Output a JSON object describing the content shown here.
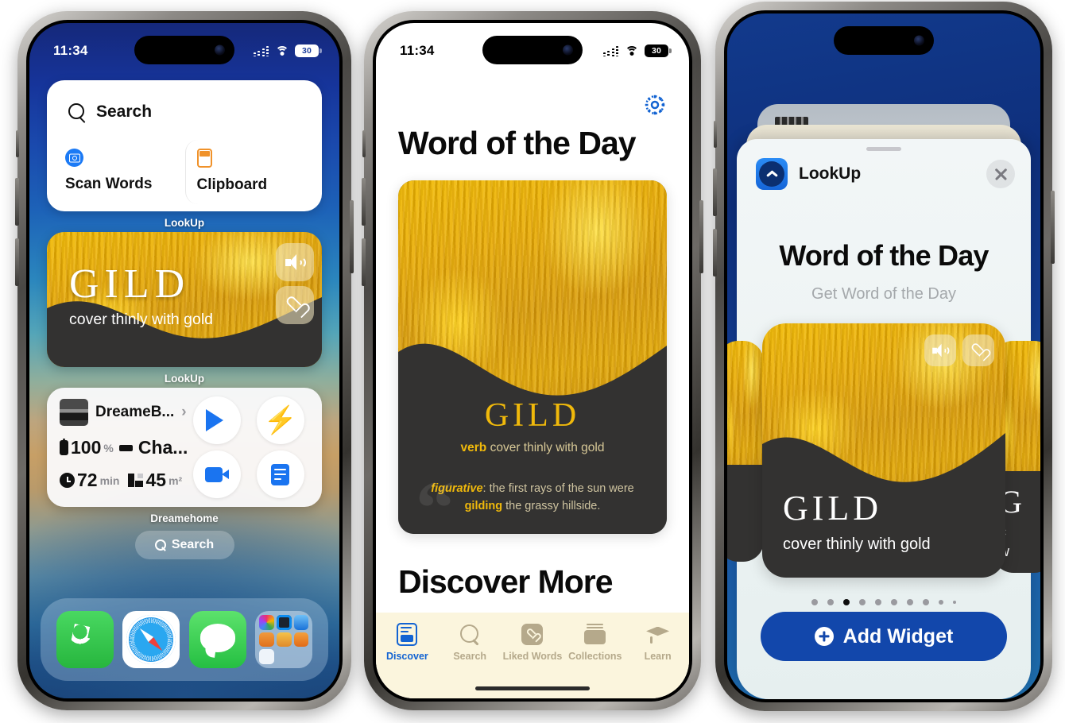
{
  "phone1": {
    "status": {
      "time": "11:34",
      "battery": "30",
      "wifi_icon": "wifi-icon",
      "signal_icon": "cellular-signal-icon"
    },
    "lookup_search_widget": {
      "search_placeholder": "Search",
      "search_icon": "search-icon",
      "actions": [
        {
          "label": "Scan Words",
          "icon": "camera-icon"
        },
        {
          "label": "Clipboard",
          "icon": "clipboard-icon"
        }
      ],
      "widget_name": "LookUp"
    },
    "gild_widget": {
      "word": "GILD",
      "definition": "cover thinly with gold",
      "speaker_icon": "speaker-icon",
      "heart_icon": "heart-icon",
      "widget_name": "LookUp"
    },
    "dream_widget": {
      "device_name": "DreameB...",
      "chevron_icon": "chevron-right-icon",
      "battery_value": "100",
      "battery_unit": "%",
      "charge_status": "Cha...",
      "time_value": "72",
      "time_unit": "min",
      "area_value": "45",
      "area_unit": "m²",
      "buttons": [
        {
          "icon": "play-icon"
        },
        {
          "icon": "bolt-icon"
        },
        {
          "icon": "video-icon"
        },
        {
          "icon": "document-icon"
        }
      ],
      "widget_name": "Dreamehome"
    },
    "home_search": {
      "label": "Search",
      "icon": "search-icon"
    },
    "dock": [
      {
        "name": "Phone",
        "icon": "phone-icon"
      },
      {
        "name": "Safari",
        "icon": "safari-icon"
      },
      {
        "name": "Messages",
        "icon": "messages-icon"
      },
      {
        "name": "Folder",
        "icon": "folder-icon"
      }
    ]
  },
  "phone2": {
    "status": {
      "time": "11:34",
      "battery": "30"
    },
    "settings_icon": "gear-icon",
    "title": "Word of the Day",
    "card": {
      "word": "GILD",
      "part_of_speech": "verb",
      "definition": "cover thinly with gold",
      "example_label": "figurative",
      "example_prefix": ": the first rays of the sun were",
      "example_bold": "gilding",
      "example_suffix": "the grassy hillside.",
      "quote_icon": "quote-icon"
    },
    "section_title": "Discover More",
    "tabs": [
      {
        "label": "Discover",
        "icon": "discover-icon",
        "active": true
      },
      {
        "label": "Search",
        "icon": "search-icon",
        "active": false
      },
      {
        "label": "Liked Words",
        "icon": "heart-icon",
        "active": false
      },
      {
        "label": "Collections",
        "icon": "collections-icon",
        "active": false
      },
      {
        "label": "Learn",
        "icon": "graduation-cap-icon",
        "active": false
      }
    ]
  },
  "phone3": {
    "sheet": {
      "app_name": "LookUp",
      "app_icon": "lookup-chevron-up-icon",
      "close_icon": "close-icon",
      "grabber_icon": "sheet-grabber",
      "title": "Word of the Day",
      "subtitle": "Get Word of the Day",
      "preview": {
        "word": "GILD",
        "definition": "cover thinly with gold",
        "speaker_icon": "speaker-icon",
        "heart_icon": "heart-icon"
      },
      "page_dots": {
        "count": 10,
        "active_index": 2
      },
      "add_button": {
        "label": "Add Widget",
        "icon": "plus-circle-icon"
      }
    }
  },
  "colors": {
    "gold": "#e0a506",
    "dark_card": "#333231",
    "accent_blue": "#1247ab",
    "tab_active": "#1263d2",
    "tab_inactive": "#b5a98b",
    "tabbar_bg": "#fbf5dd"
  }
}
